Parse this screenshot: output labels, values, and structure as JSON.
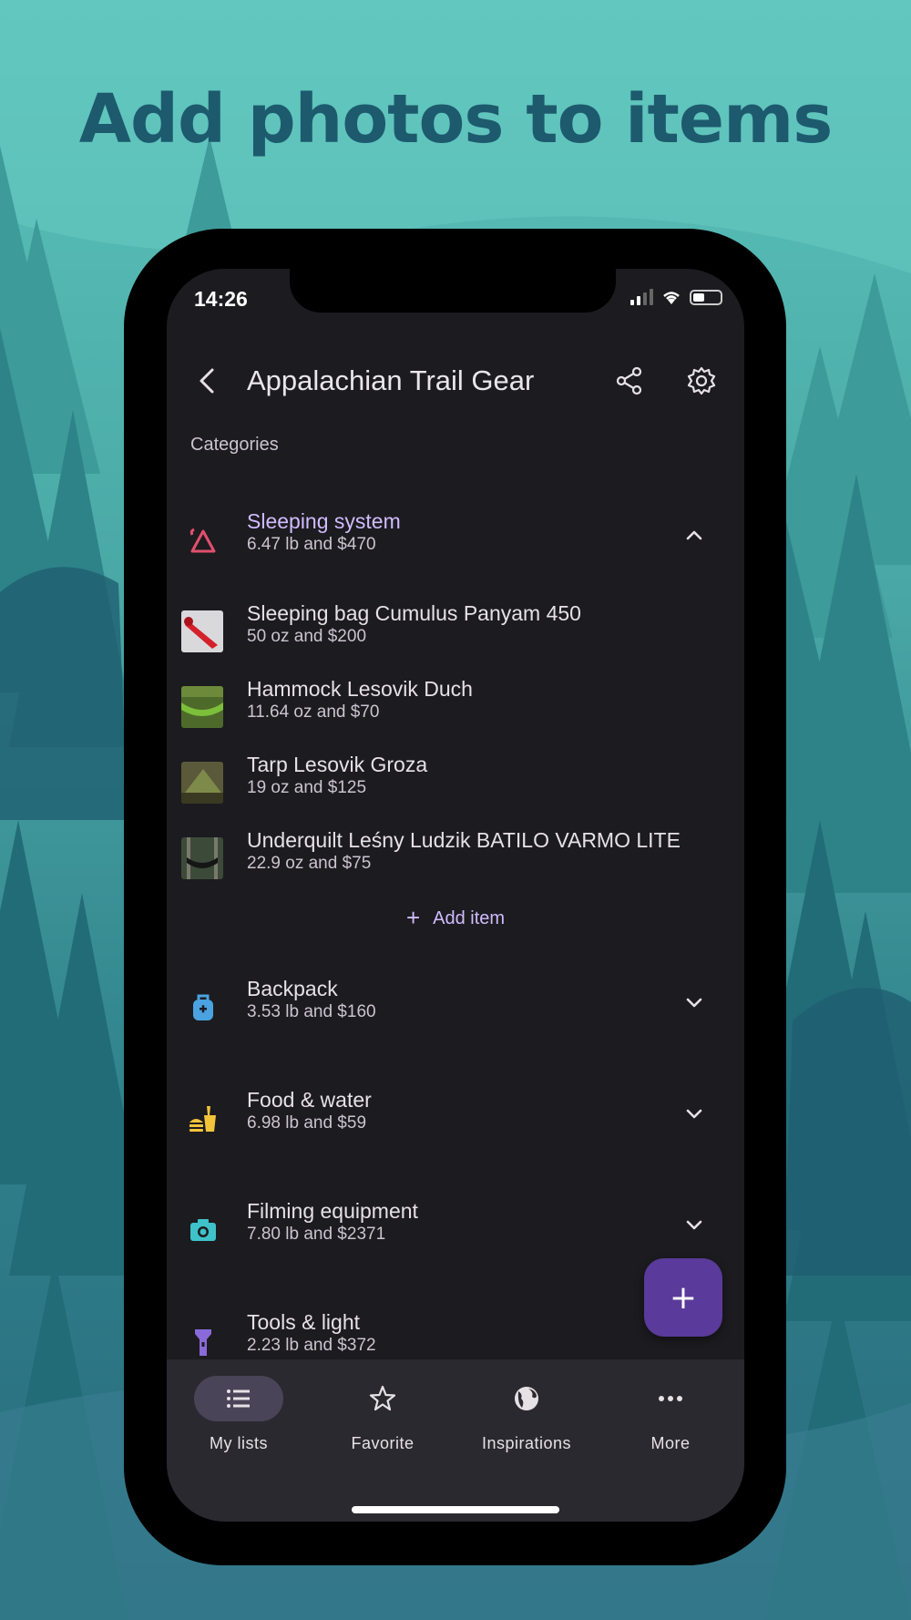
{
  "headline": "Add photos to items",
  "status": {
    "time": "14:26"
  },
  "appbar": {
    "title": "Appalachian Trail Gear"
  },
  "section_label": "Categories",
  "categories": [
    {
      "name": "Sleeping system",
      "sub": "6.47 lb and $470",
      "icon": "tent-icon",
      "color": "#e0506e",
      "expanded": true
    },
    {
      "name": "Backpack",
      "sub": "3.53 lb and $160",
      "icon": "backpack-icon",
      "color": "#4aa3e0",
      "expanded": false
    },
    {
      "name": "Food & water",
      "sub": "6.98 lb and $59",
      "icon": "food-icon",
      "color": "#f2c43a",
      "expanded": false
    },
    {
      "name": "Filming equipment",
      "sub": "7.80 lb and $2371",
      "icon": "camera-icon",
      "color": "#3fc1c9",
      "expanded": false
    },
    {
      "name": "Tools & light",
      "sub": "2.23 lb and $372",
      "icon": "flashlight-icon",
      "color": "#8a6ad8",
      "expanded": false
    }
  ],
  "items": [
    {
      "name": "Sleeping bag Cumulus Panyam 450",
      "sub": "50 oz and $200"
    },
    {
      "name": "Hammock Lesovik Duch",
      "sub": "11.64 oz and $70"
    },
    {
      "name": "Tarp Lesovik Groza",
      "sub": "19 oz and $125"
    },
    {
      "name": "Underquilt Leśny Ludzik BATILO VARMO LITE",
      "sub": "22.9 oz and $75"
    }
  ],
  "add_item": {
    "plus": "+",
    "label": "Add item"
  },
  "fab": {
    "label": "+"
  },
  "nav": [
    {
      "label": "My lists",
      "icon": "list-icon",
      "active": true
    },
    {
      "label": "Favorite",
      "icon": "star-icon",
      "active": false
    },
    {
      "label": "Inspirations",
      "icon": "globe-icon",
      "active": false
    },
    {
      "label": "More",
      "icon": "more-dots-icon",
      "active": false
    }
  ]
}
